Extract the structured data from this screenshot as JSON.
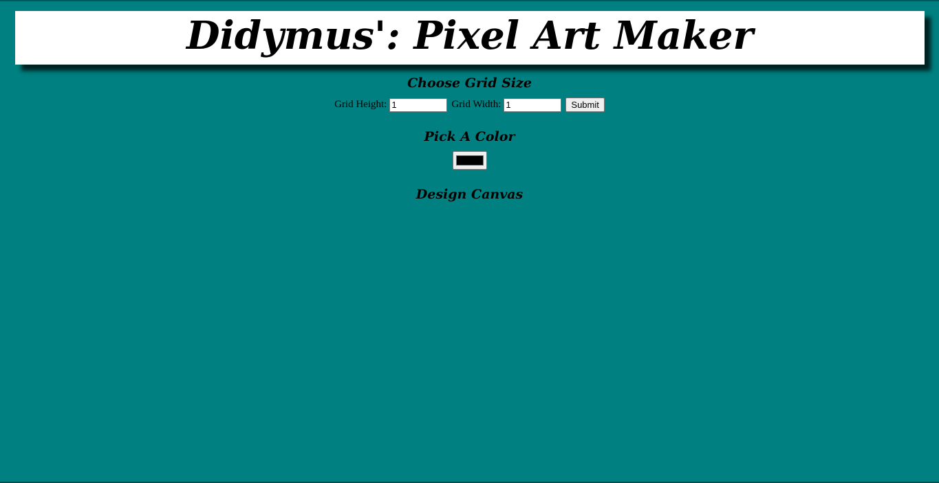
{
  "header": {
    "title": "Didymus': Pixel Art Maker"
  },
  "grid_size": {
    "heading": "Choose Grid Size",
    "height_label": "Grid Height:",
    "height_value": "1",
    "width_label": "Grid Width:",
    "width_value": "1",
    "submit_label": "Submit"
  },
  "color_picker": {
    "heading": "Pick A Color",
    "value": "#000000"
  },
  "canvas": {
    "heading": "Design Canvas"
  },
  "colors": {
    "background": "#008080",
    "header_bg": "#ffffff"
  }
}
